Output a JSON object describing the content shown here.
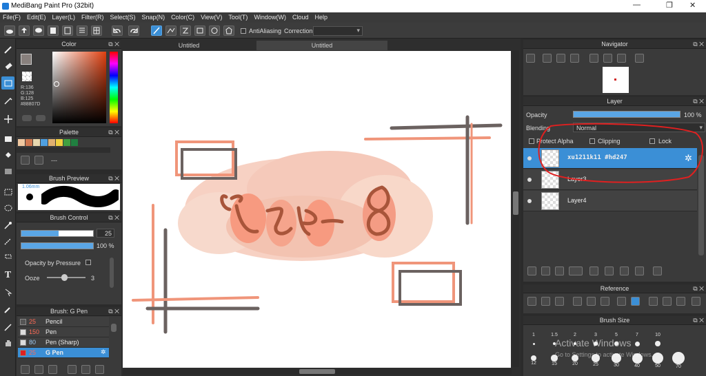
{
  "window": {
    "title": "MediBang Paint Pro (32bit)",
    "min": "—",
    "max": "❐",
    "close": "✕"
  },
  "menu": [
    "File(F)",
    "Edit(E)",
    "Layer(L)",
    "Filter(R)",
    "Select(S)",
    "Snap(N)",
    "Color(C)",
    "View(V)",
    "Tool(T)",
    "Window(W)",
    "Cloud",
    "Help"
  ],
  "toolbar": {
    "antialiasing_label": "AntiAliasing",
    "correction_label": "Correction",
    "correction_value": ""
  },
  "tabs": [
    "Untitled",
    "Untitled"
  ],
  "color_panel": {
    "title": "Color",
    "readout": [
      "R:136",
      "G:128",
      "B:125",
      "#88807D"
    ],
    "primary": "#88807D"
  },
  "palette_panel": {
    "title": "Palette",
    "colors": [
      "#f0c8a0",
      "#d07850",
      "#e8d8b0",
      "#50a0e0",
      "#e0b070",
      "#f0d040",
      "#40a040",
      "#208040"
    ],
    "dash": "---"
  },
  "brush_preview": {
    "title": "Brush Preview",
    "size_label": "1.06mm"
  },
  "brush_control": {
    "title": "Brush Control",
    "size_value": "25",
    "opacity_value": "100 %",
    "opacity_pressure_label": "Opacity by Pressure",
    "ooze_label": "Ooze",
    "ooze_value": "3",
    "size_level": 0.52,
    "ooze_level": 0.45
  },
  "brush_list": {
    "title": "Brush: G Pen",
    "items": [
      {
        "size": "25",
        "name": "Pencil",
        "color": "#555555"
      },
      {
        "size": "150",
        "name": "Pen",
        "color": "#dddddd"
      },
      {
        "size": "80",
        "name": "Pen (Sharp)",
        "color": "#dddddd"
      },
      {
        "size": "25",
        "name": "G Pen",
        "color": "#e02020",
        "selected": true
      }
    ]
  },
  "navigator": {
    "title": "Navigator"
  },
  "layer_panel": {
    "title": "Layer",
    "opacity_label": "Opacity",
    "opacity_value": "100 %",
    "blending_label": "Blending",
    "blending_value": "Normal",
    "protect_alpha_label": "Protect Alpha",
    "clipping_label": "Clipping",
    "lock_label": "Lock",
    "layers": [
      {
        "name": "xu1211k11 #hd247",
        "selected": true
      },
      {
        "name": "Layer3"
      },
      {
        "name": "Layer4"
      }
    ]
  },
  "reference": {
    "title": "Reference"
  },
  "brush_size": {
    "title": "Brush Size",
    "row1": [
      "1",
      "1.5",
      "2",
      "3",
      "5",
      "7",
      "10"
    ],
    "row2": [
      "12",
      "15",
      "20",
      "25",
      "30",
      "40",
      "50",
      "70"
    ],
    "watermark": "Activate Windows",
    "watermark_sub": "Go to Settings to activate Windows."
  }
}
